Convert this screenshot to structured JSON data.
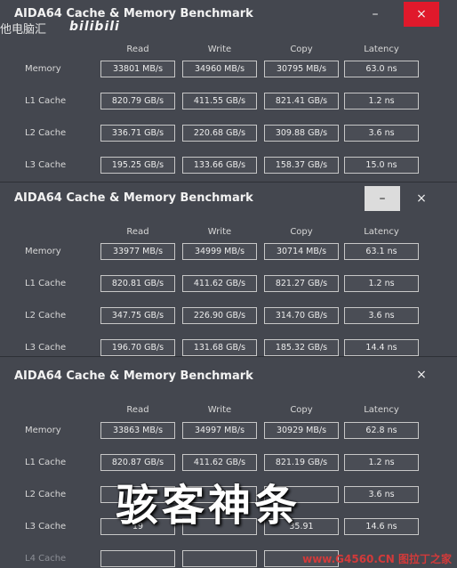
{
  "watermark": {
    "channel": "他电脑汇",
    "logo": "bilibili"
  },
  "window_title": "AIDA64 Cache & Memory Benchmark",
  "columns": [
    "Read",
    "Write",
    "Copy",
    "Latency"
  ],
  "controls": {
    "minimize": "–",
    "close": "×"
  },
  "windows": [
    {
      "rows": [
        {
          "label": "Memory",
          "values": [
            "33801 MB/s",
            "34960 MB/s",
            "30795 MB/s",
            "63.0 ns"
          ]
        },
        {
          "label": "L1 Cache",
          "values": [
            "820.79 GB/s",
            "411.55 GB/s",
            "821.41 GB/s",
            "1.2 ns"
          ]
        },
        {
          "label": "L2 Cache",
          "values": [
            "336.71 GB/s",
            "220.68 GB/s",
            "309.88 GB/s",
            "3.6 ns"
          ]
        },
        {
          "label": "L3 Cache",
          "values": [
            "195.25 GB/s",
            "133.66 GB/s",
            "158.37 GB/s",
            "15.0 ns"
          ]
        }
      ]
    },
    {
      "rows": [
        {
          "label": "Memory",
          "values": [
            "33977 MB/s",
            "34999 MB/s",
            "30714 MB/s",
            "63.1 ns"
          ]
        },
        {
          "label": "L1 Cache",
          "values": [
            "820.81 GB/s",
            "411.62 GB/s",
            "821.27 GB/s",
            "1.2 ns"
          ]
        },
        {
          "label": "L2 Cache",
          "values": [
            "347.75 GB/s",
            "226.90 GB/s",
            "314.70 GB/s",
            "3.6 ns"
          ]
        },
        {
          "label": "L3 Cache",
          "values": [
            "196.70 GB/s",
            "131.68 GB/s",
            "185.32 GB/s",
            "14.4 ns"
          ]
        }
      ]
    },
    {
      "rows": [
        {
          "label": "Memory",
          "values": [
            "33863 MB/s",
            "34997 MB/s",
            "30929 MB/s",
            "62.8 ns"
          ]
        },
        {
          "label": "L1 Cache",
          "values": [
            "820.87 GB/s",
            "411.62 GB/s",
            "821.19 GB/s",
            "1.2 ns"
          ]
        },
        {
          "label": "L2 Cache",
          "values": [
            "",
            "",
            "",
            "3.6 ns"
          ]
        },
        {
          "label": "L3 Cache",
          "values": [
            "19",
            "",
            "35.91",
            "14.6 ns"
          ]
        },
        {
          "label": "L4 Cache",
          "values": [
            "",
            "",
            "",
            ""
          ]
        }
      ]
    }
  ],
  "overlay_text": "骇客神条",
  "site_watermark": "www.G4560.CN 图拉丁之家"
}
